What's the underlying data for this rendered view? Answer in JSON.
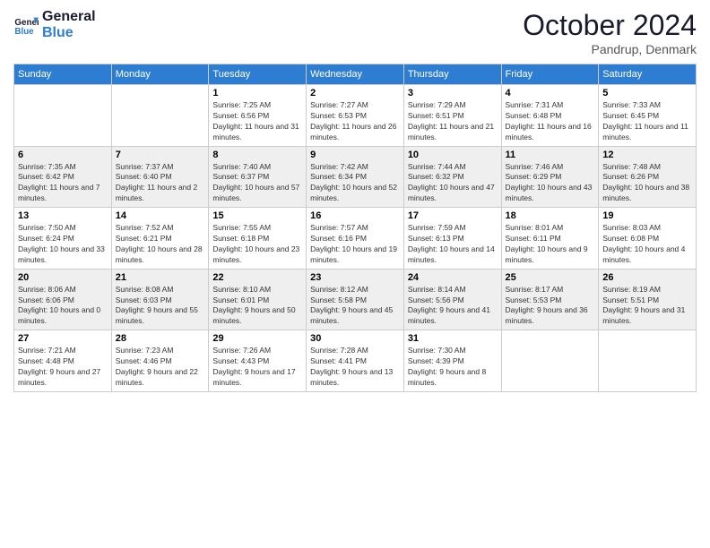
{
  "header": {
    "logo_line1": "General",
    "logo_line2": "Blue",
    "month": "October 2024",
    "location": "Pandrup, Denmark"
  },
  "weekdays": [
    "Sunday",
    "Monday",
    "Tuesday",
    "Wednesday",
    "Thursday",
    "Friday",
    "Saturday"
  ],
  "weeks": [
    [
      {
        "day": "",
        "sunrise": "",
        "sunset": "",
        "daylight": ""
      },
      {
        "day": "",
        "sunrise": "",
        "sunset": "",
        "daylight": ""
      },
      {
        "day": "1",
        "sunrise": "Sunrise: 7:25 AM",
        "sunset": "Sunset: 6:56 PM",
        "daylight": "Daylight: 11 hours and 31 minutes."
      },
      {
        "day": "2",
        "sunrise": "Sunrise: 7:27 AM",
        "sunset": "Sunset: 6:53 PM",
        "daylight": "Daylight: 11 hours and 26 minutes."
      },
      {
        "day": "3",
        "sunrise": "Sunrise: 7:29 AM",
        "sunset": "Sunset: 6:51 PM",
        "daylight": "Daylight: 11 hours and 21 minutes."
      },
      {
        "day": "4",
        "sunrise": "Sunrise: 7:31 AM",
        "sunset": "Sunset: 6:48 PM",
        "daylight": "Daylight: 11 hours and 16 minutes."
      },
      {
        "day": "5",
        "sunrise": "Sunrise: 7:33 AM",
        "sunset": "Sunset: 6:45 PM",
        "daylight": "Daylight: 11 hours and 11 minutes."
      }
    ],
    [
      {
        "day": "6",
        "sunrise": "Sunrise: 7:35 AM",
        "sunset": "Sunset: 6:42 PM",
        "daylight": "Daylight: 11 hours and 7 minutes."
      },
      {
        "day": "7",
        "sunrise": "Sunrise: 7:37 AM",
        "sunset": "Sunset: 6:40 PM",
        "daylight": "Daylight: 11 hours and 2 minutes."
      },
      {
        "day": "8",
        "sunrise": "Sunrise: 7:40 AM",
        "sunset": "Sunset: 6:37 PM",
        "daylight": "Daylight: 10 hours and 57 minutes."
      },
      {
        "day": "9",
        "sunrise": "Sunrise: 7:42 AM",
        "sunset": "Sunset: 6:34 PM",
        "daylight": "Daylight: 10 hours and 52 minutes."
      },
      {
        "day": "10",
        "sunrise": "Sunrise: 7:44 AM",
        "sunset": "Sunset: 6:32 PM",
        "daylight": "Daylight: 10 hours and 47 minutes."
      },
      {
        "day": "11",
        "sunrise": "Sunrise: 7:46 AM",
        "sunset": "Sunset: 6:29 PM",
        "daylight": "Daylight: 10 hours and 43 minutes."
      },
      {
        "day": "12",
        "sunrise": "Sunrise: 7:48 AM",
        "sunset": "Sunset: 6:26 PM",
        "daylight": "Daylight: 10 hours and 38 minutes."
      }
    ],
    [
      {
        "day": "13",
        "sunrise": "Sunrise: 7:50 AM",
        "sunset": "Sunset: 6:24 PM",
        "daylight": "Daylight: 10 hours and 33 minutes."
      },
      {
        "day": "14",
        "sunrise": "Sunrise: 7:52 AM",
        "sunset": "Sunset: 6:21 PM",
        "daylight": "Daylight: 10 hours and 28 minutes."
      },
      {
        "day": "15",
        "sunrise": "Sunrise: 7:55 AM",
        "sunset": "Sunset: 6:18 PM",
        "daylight": "Daylight: 10 hours and 23 minutes."
      },
      {
        "day": "16",
        "sunrise": "Sunrise: 7:57 AM",
        "sunset": "Sunset: 6:16 PM",
        "daylight": "Daylight: 10 hours and 19 minutes."
      },
      {
        "day": "17",
        "sunrise": "Sunrise: 7:59 AM",
        "sunset": "Sunset: 6:13 PM",
        "daylight": "Daylight: 10 hours and 14 minutes."
      },
      {
        "day": "18",
        "sunrise": "Sunrise: 8:01 AM",
        "sunset": "Sunset: 6:11 PM",
        "daylight": "Daylight: 10 hours and 9 minutes."
      },
      {
        "day": "19",
        "sunrise": "Sunrise: 8:03 AM",
        "sunset": "Sunset: 6:08 PM",
        "daylight": "Daylight: 10 hours and 4 minutes."
      }
    ],
    [
      {
        "day": "20",
        "sunrise": "Sunrise: 8:06 AM",
        "sunset": "Sunset: 6:06 PM",
        "daylight": "Daylight: 10 hours and 0 minutes."
      },
      {
        "day": "21",
        "sunrise": "Sunrise: 8:08 AM",
        "sunset": "Sunset: 6:03 PM",
        "daylight": "Daylight: 9 hours and 55 minutes."
      },
      {
        "day": "22",
        "sunrise": "Sunrise: 8:10 AM",
        "sunset": "Sunset: 6:01 PM",
        "daylight": "Daylight: 9 hours and 50 minutes."
      },
      {
        "day": "23",
        "sunrise": "Sunrise: 8:12 AM",
        "sunset": "Sunset: 5:58 PM",
        "daylight": "Daylight: 9 hours and 45 minutes."
      },
      {
        "day": "24",
        "sunrise": "Sunrise: 8:14 AM",
        "sunset": "Sunset: 5:56 PM",
        "daylight": "Daylight: 9 hours and 41 minutes."
      },
      {
        "day": "25",
        "sunrise": "Sunrise: 8:17 AM",
        "sunset": "Sunset: 5:53 PM",
        "daylight": "Daylight: 9 hours and 36 minutes."
      },
      {
        "day": "26",
        "sunrise": "Sunrise: 8:19 AM",
        "sunset": "Sunset: 5:51 PM",
        "daylight": "Daylight: 9 hours and 31 minutes."
      }
    ],
    [
      {
        "day": "27",
        "sunrise": "Sunrise: 7:21 AM",
        "sunset": "Sunset: 4:48 PM",
        "daylight": "Daylight: 9 hours and 27 minutes."
      },
      {
        "day": "28",
        "sunrise": "Sunrise: 7:23 AM",
        "sunset": "Sunset: 4:46 PM",
        "daylight": "Daylight: 9 hours and 22 minutes."
      },
      {
        "day": "29",
        "sunrise": "Sunrise: 7:26 AM",
        "sunset": "Sunset: 4:43 PM",
        "daylight": "Daylight: 9 hours and 17 minutes."
      },
      {
        "day": "30",
        "sunrise": "Sunrise: 7:28 AM",
        "sunset": "Sunset: 4:41 PM",
        "daylight": "Daylight: 9 hours and 13 minutes."
      },
      {
        "day": "31",
        "sunrise": "Sunrise: 7:30 AM",
        "sunset": "Sunset: 4:39 PM",
        "daylight": "Daylight: 9 hours and 8 minutes."
      },
      {
        "day": "",
        "sunrise": "",
        "sunset": "",
        "daylight": ""
      },
      {
        "day": "",
        "sunrise": "",
        "sunset": "",
        "daylight": ""
      }
    ]
  ]
}
